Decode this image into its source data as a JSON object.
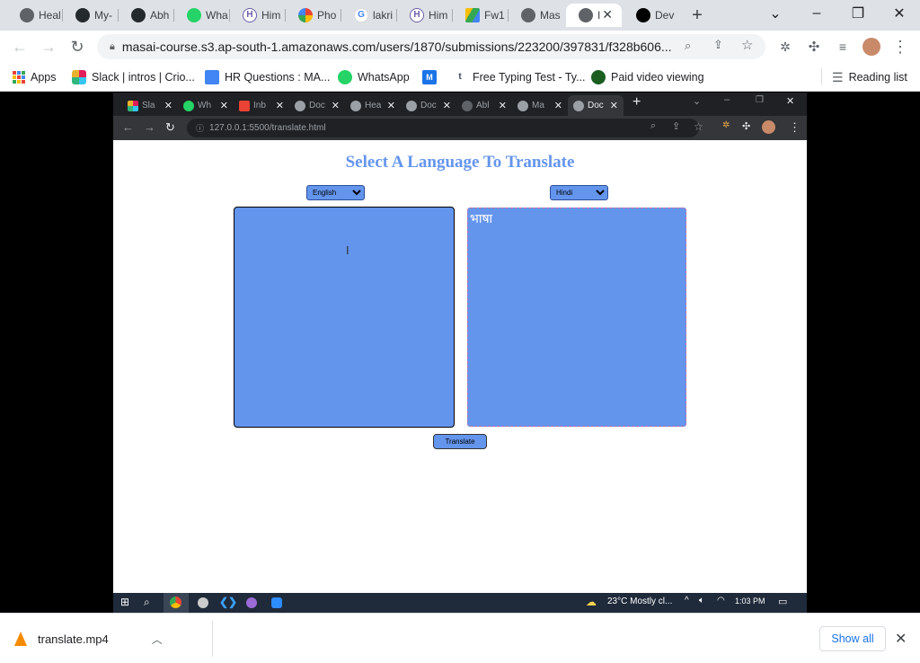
{
  "outer_browser": {
    "tabs": [
      {
        "label": "Heal",
        "icon": "globe-icon"
      },
      {
        "label": "My-",
        "icon": "github-icon"
      },
      {
        "label": "Abh",
        "icon": "github-icon"
      },
      {
        "label": "Wha",
        "icon": "whatsapp-icon"
      },
      {
        "label": "Him",
        "icon": "h-icon"
      },
      {
        "label": "Pho",
        "icon": "photos-icon"
      },
      {
        "label": "lakri",
        "icon": "google-icon"
      },
      {
        "label": "Him",
        "icon": "h-icon"
      },
      {
        "label": "Fw1",
        "icon": "drive-icon"
      },
      {
        "label": "Mas",
        "icon": "globe-icon"
      },
      {
        "label": "I",
        "icon": "globe-icon"
      },
      {
        "label": "Dev",
        "icon": "vercel-icon"
      }
    ],
    "url": "masai-course.s3.ap-south-1.amazonaws.com/users/1870/submissions/223200/397831/f328b606...",
    "bookmarks": [
      {
        "label": "Apps",
        "icon": "apps-grid-icon"
      },
      {
        "label": "Slack | intros | Crio...",
        "icon": "slack-icon"
      },
      {
        "label": "HR Questions : MA...",
        "icon": "docs-icon"
      },
      {
        "label": "WhatsApp",
        "icon": "whatsapp-icon"
      },
      {
        "label": "",
        "icon": "mi-icon"
      },
      {
        "label": "Free Typing Test - Ty...",
        "icon": "tumblr-icon"
      },
      {
        "label": "Paid video viewing",
        "icon": "leaf-icon"
      }
    ],
    "reading_list": "Reading list"
  },
  "inner_browser": {
    "tabs": [
      {
        "label": "Sla",
        "icon": "slack-icon"
      },
      {
        "label": "Wh",
        "icon": "whatsapp-icon"
      },
      {
        "label": "Inb",
        "icon": "gmail-icon"
      },
      {
        "label": "Doc",
        "icon": "globe-icon"
      },
      {
        "label": "Hea",
        "icon": "globe-icon"
      },
      {
        "label": "Doc",
        "icon": "globe-icon"
      },
      {
        "label": "Abl",
        "icon": "github-icon"
      },
      {
        "label": "Ma",
        "icon": "globe-icon"
      },
      {
        "label": "Doc",
        "icon": "globe-icon"
      }
    ],
    "url": "127.0.0.1:5500/translate.html"
  },
  "page": {
    "title": "Select A Language To Translate",
    "source_language": "English",
    "target_language": "Hindi",
    "source_text": "",
    "target_text": "भाषा",
    "translate_label": "Translate"
  },
  "taskbar": {
    "weather": "23°C  Mostly cl...",
    "time": "1:03 PM"
  },
  "downloads": {
    "file_name": "translate.mp4",
    "show_all": "Show all"
  },
  "colors": {
    "accent": "#6495ed",
    "title": "#6495ed"
  }
}
